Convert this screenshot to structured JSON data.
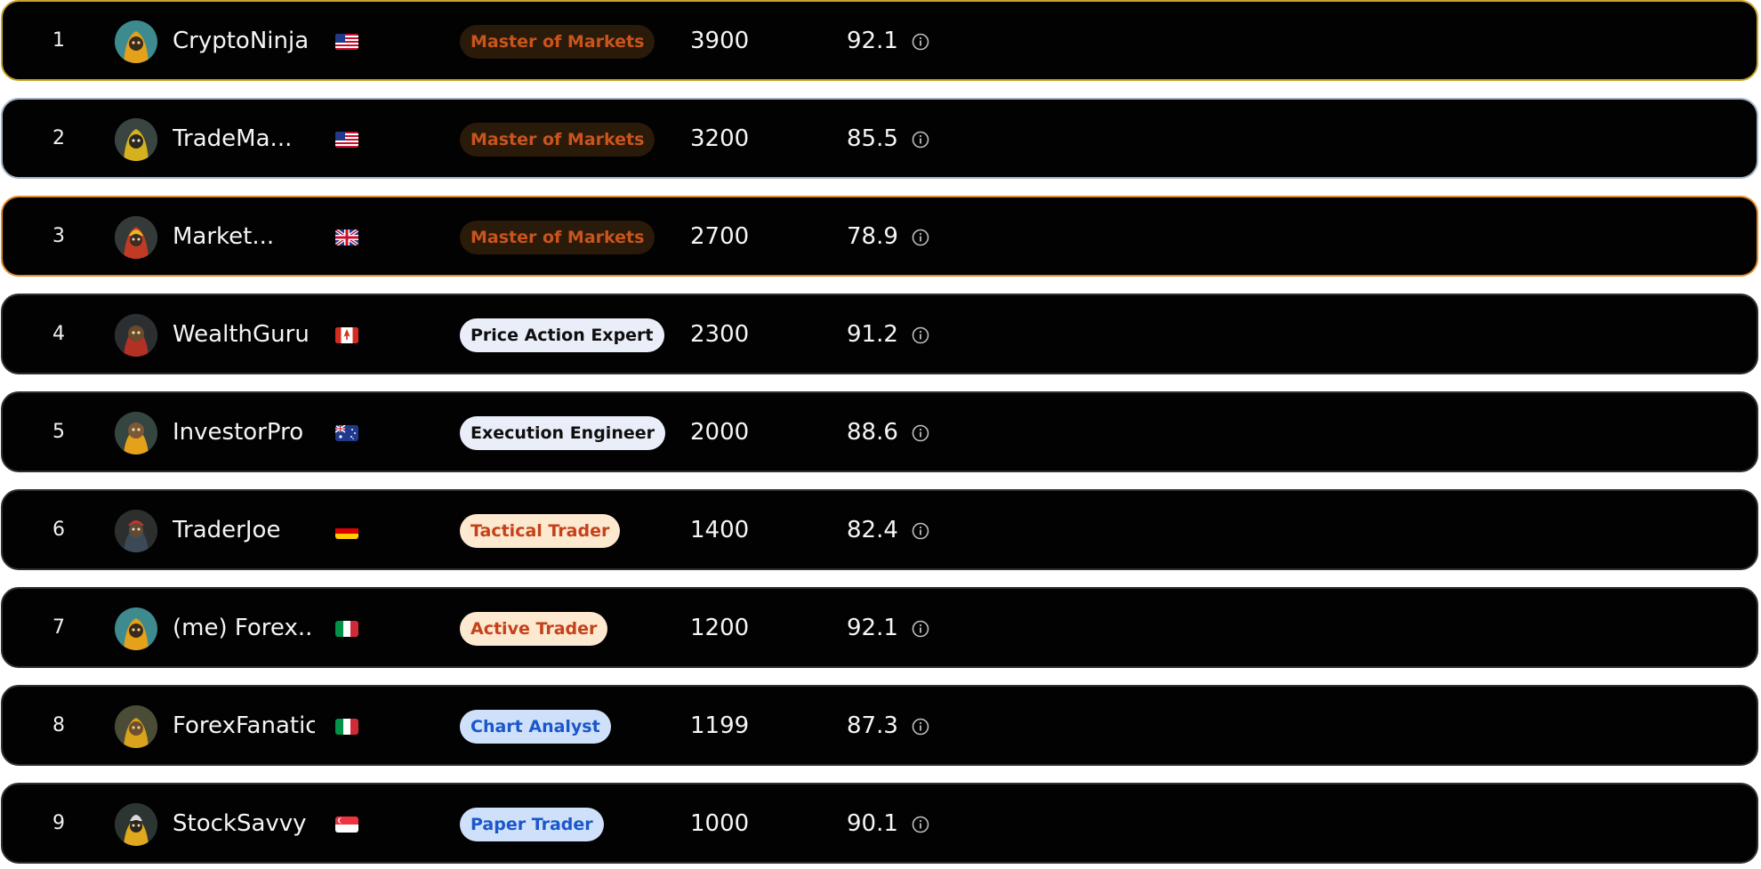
{
  "leaderboard": {
    "rows": [
      {
        "rank": "1",
        "name": "CryptoNinja",
        "flag": "us-flag",
        "badge": "Master of Markets",
        "points": "3900",
        "score": "92.1",
        "highlight": "gold"
      },
      {
        "rank": "2",
        "name": "TradeMa...",
        "flag": "us-flag",
        "badge": "Master of Markets",
        "points": "3200",
        "score": "85.5",
        "highlight": "silver"
      },
      {
        "rank": "3",
        "name": "Market...",
        "flag": "uk-flag",
        "badge": "Master of Markets",
        "points": "2700",
        "score": "78.9",
        "highlight": "bronze"
      },
      {
        "rank": "4",
        "name": "WealthGuru",
        "flag": "canada-flag",
        "badge": "Price Action Expert",
        "points": "2300",
        "score": "91.2",
        "highlight": "none"
      },
      {
        "rank": "5",
        "name": "InvestorPro",
        "flag": "australia-flag",
        "badge": "Execution Engineer",
        "points": "2000",
        "score": "88.6",
        "highlight": "none"
      },
      {
        "rank": "6",
        "name": "TraderJoe",
        "flag": "germany-flag",
        "badge": "Tactical Trader",
        "points": "1400",
        "score": "82.4",
        "highlight": "none"
      },
      {
        "rank": "7",
        "name": "(me) Forex...",
        "flag": "italy-flag",
        "badge": "Active Trader",
        "points": "1200",
        "score": "92.1",
        "highlight": "none"
      },
      {
        "rank": "8",
        "name": "ForexFanatic",
        "flag": "italy-flag",
        "badge": "Chart Analyst",
        "points": "1199",
        "score": "87.3",
        "highlight": "none"
      },
      {
        "rank": "9",
        "name": "StockSavvy",
        "flag": "singapore-flag",
        "badge": "Paper Trader",
        "points": "1000",
        "score": "90.1",
        "highlight": "none"
      }
    ]
  },
  "colors": {
    "row_background": "#020202",
    "gold_border": "#c9a227",
    "silver_border": "#9fb3c5",
    "bronze_border": "#e08a2a",
    "master_badge_bg": "#2a1a09",
    "master_badge_text": "#c9541d",
    "expert_badge_bg": "#e9eef9",
    "trader_badge_bg": "#fde8d0",
    "trader_badge_text": "#c4421a",
    "analyst_badge_bg": "#cfe0fb",
    "analyst_badge_text": "#1a57c9"
  },
  "icons": {
    "avatar": "avatar-icon",
    "info": "info-icon"
  }
}
